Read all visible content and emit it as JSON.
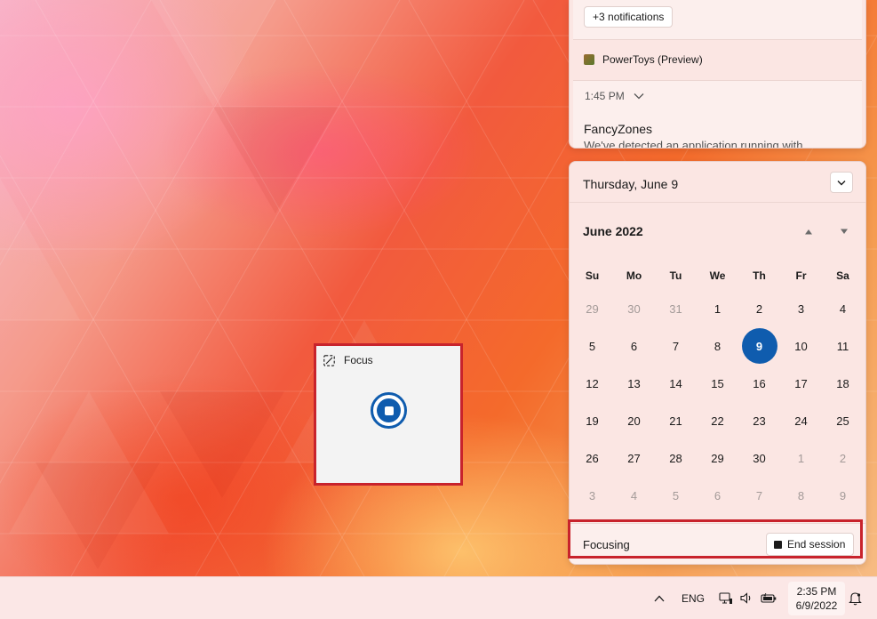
{
  "notifications": {
    "more_button": "+3 notifications",
    "app_name": "PowerToys (Preview)",
    "time": "1:45 PM",
    "title": "FancyZones",
    "body": "We've detected an application running with"
  },
  "calendar": {
    "date_header": "Thursday, June 9",
    "month": "June 2022",
    "weekdays": [
      "Su",
      "Mo",
      "Tu",
      "We",
      "Th",
      "Fr",
      "Sa"
    ],
    "weeks": [
      [
        [
          "29",
          "other"
        ],
        [
          "30",
          "other"
        ],
        [
          "31",
          "other"
        ],
        [
          "1",
          ""
        ],
        [
          "2",
          ""
        ],
        [
          "3",
          ""
        ],
        [
          "4",
          ""
        ]
      ],
      [
        [
          "5",
          ""
        ],
        [
          "6",
          ""
        ],
        [
          "7",
          ""
        ],
        [
          "8",
          ""
        ],
        [
          "9",
          "today"
        ],
        [
          "10",
          ""
        ],
        [
          "11",
          ""
        ]
      ],
      [
        [
          "12",
          ""
        ],
        [
          "13",
          ""
        ],
        [
          "14",
          ""
        ],
        [
          "15",
          ""
        ],
        [
          "16",
          ""
        ],
        [
          "17",
          ""
        ],
        [
          "18",
          ""
        ]
      ],
      [
        [
          "19",
          ""
        ],
        [
          "20",
          ""
        ],
        [
          "21",
          ""
        ],
        [
          "22",
          ""
        ],
        [
          "23",
          ""
        ],
        [
          "24",
          ""
        ],
        [
          "25",
          ""
        ]
      ],
      [
        [
          "26",
          ""
        ],
        [
          "27",
          ""
        ],
        [
          "28",
          ""
        ],
        [
          "29",
          ""
        ],
        [
          "30",
          ""
        ],
        [
          "1",
          "other"
        ],
        [
          "2",
          "other"
        ]
      ],
      [
        [
          "3",
          "other"
        ],
        [
          "4",
          "other"
        ],
        [
          "5",
          "other"
        ],
        [
          "6",
          "other"
        ],
        [
          "7",
          "other"
        ],
        [
          "8",
          "other"
        ],
        [
          "9",
          "other"
        ]
      ]
    ],
    "focus_label": "Focusing",
    "end_session": "End session"
  },
  "focus_widget": {
    "title": "Focus"
  },
  "taskbar": {
    "language": "ENG",
    "time": "2:35 PM",
    "date": "6/9/2022"
  },
  "colors": {
    "accent": "#0f5cae",
    "highlight": "#c8232c"
  }
}
